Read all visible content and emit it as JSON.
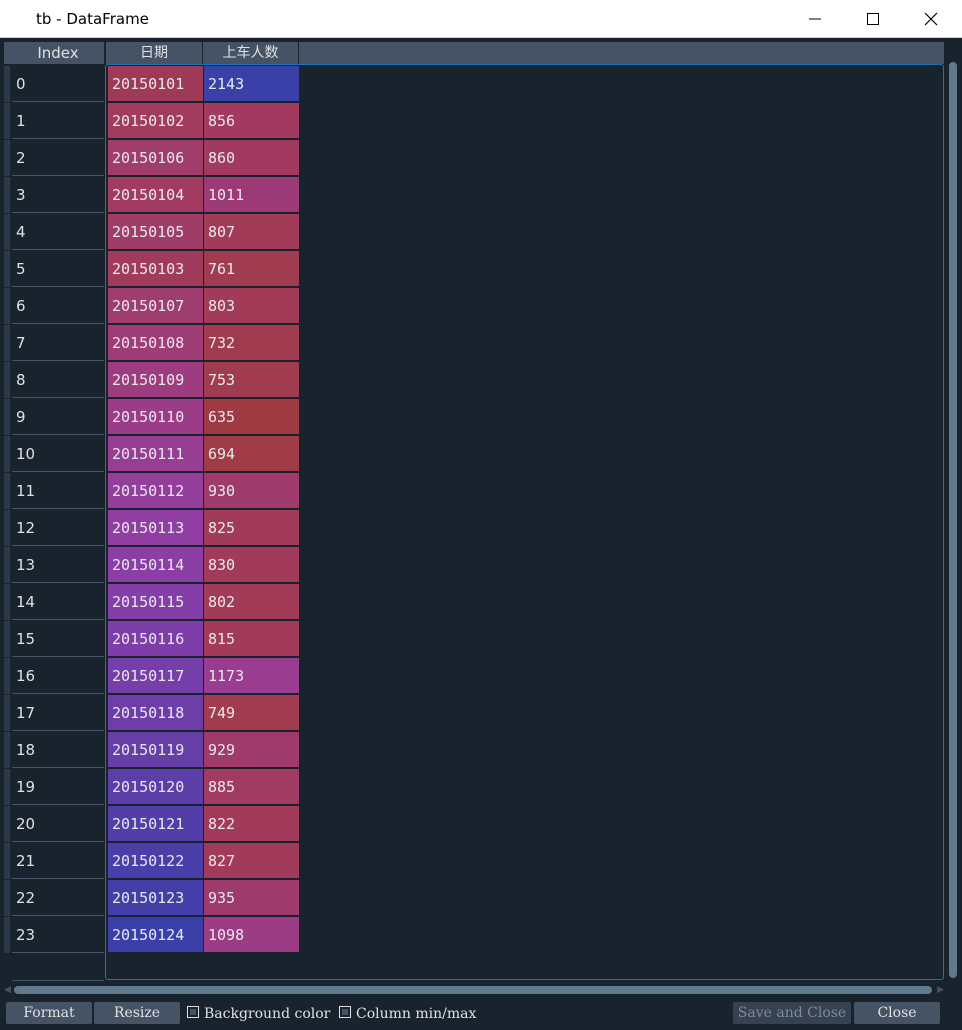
{
  "window": {
    "title": "tb - DataFrame",
    "controls": {
      "minimize": "minimize",
      "maximize": "maximize",
      "close": "close"
    }
  },
  "table": {
    "index_header": "Index",
    "columns": [
      "日期",
      "上车人数"
    ],
    "rows": [
      {
        "index": "0",
        "date": "20150101",
        "count": "2143",
        "date_color": "#9e3a56",
        "count_color": "#3b3fa8"
      },
      {
        "index": "1",
        "date": "20150102",
        "count": "856",
        "date_color": "#a23c5c",
        "count_color": "#a13a5e"
      },
      {
        "index": "2",
        "date": "20150106",
        "count": "860",
        "date_color": "#a03d6a",
        "count_color": "#a13a5e"
      },
      {
        "index": "3",
        "date": "20150104",
        "count": "1011",
        "date_color": "#a13c60",
        "count_color": "#9c3a78"
      },
      {
        "index": "4",
        "date": "20150105",
        "count": "807",
        "date_color": "#a03d66",
        "count_color": "#a23b58"
      },
      {
        "index": "5",
        "date": "20150103",
        "count": "761",
        "date_color": "#a13b5c",
        "count_color": "#a13b50"
      },
      {
        "index": "6",
        "date": "20150107",
        "count": "803",
        "date_color": "#9f3c70",
        "count_color": "#a23b58"
      },
      {
        "index": "7",
        "date": "20150108",
        "count": "732",
        "date_color": "#9e3c76",
        "count_color": "#a13b4e"
      },
      {
        "index": "8",
        "date": "20150109",
        "count": "753",
        "date_color": "#9d3c7e",
        "count_color": "#a13b50"
      },
      {
        "index": "9",
        "date": "20150110",
        "count": "635",
        "date_color": "#9b3c88",
        "count_color": "#9e3a42"
      },
      {
        "index": "10",
        "date": "20150111",
        "count": "694",
        "date_color": "#983d94",
        "count_color": "#a03b48"
      },
      {
        "index": "11",
        "date": "20150112",
        "count": "930",
        "date_color": "#943e9c",
        "count_color": "#9f3b6a"
      },
      {
        "index": "12",
        "date": "20150113",
        "count": "825",
        "date_color": "#903ea4",
        "count_color": "#a23b5a"
      },
      {
        "index": "13",
        "date": "20150114",
        "count": "830",
        "date_color": "#8a3ea6",
        "count_color": "#a23b5a"
      },
      {
        "index": "14",
        "date": "20150115",
        "count": "802",
        "date_color": "#843ea8",
        "count_color": "#a23b58"
      },
      {
        "index": "15",
        "date": "20150116",
        "count": "815",
        "date_color": "#7e3ea8",
        "count_color": "#a23b5a"
      },
      {
        "index": "16",
        "date": "20150117",
        "count": "1173",
        "date_color": "#763ea8",
        "count_color": "#9a3c90"
      },
      {
        "index": "17",
        "date": "20150118",
        "count": "749",
        "date_color": "#6e3ea8",
        "count_color": "#a13b50"
      },
      {
        "index": "18",
        "date": "20150119",
        "count": "929",
        "date_color": "#653ea8",
        "count_color": "#9f3b6a"
      },
      {
        "index": "19",
        "date": "20150120",
        "count": "885",
        "date_color": "#5c3ea8",
        "count_color": "#a13b62"
      },
      {
        "index": "20",
        "date": "20150121",
        "count": "822",
        "date_color": "#523ea8",
        "count_color": "#a23b5a"
      },
      {
        "index": "21",
        "date": "20150122",
        "count": "827",
        "date_color": "#4a3ea8",
        "count_color": "#a23b5a"
      },
      {
        "index": "22",
        "date": "20150123",
        "count": "935",
        "date_color": "#433ea8",
        "count_color": "#9f3b6c"
      },
      {
        "index": "23",
        "date": "20150124",
        "count": "1098",
        "date_color": "#3b40a8",
        "count_color": "#9b3c84"
      }
    ]
  },
  "toolbar": {
    "format_label": "Format",
    "resize_label": "Resize",
    "bg_color_label": "Background color",
    "minmax_label": "Column min/max",
    "save_close_label": "Save and Close",
    "close_label": "Close"
  },
  "colors": {
    "background": "#19232d",
    "header": "#455364",
    "focus_border": "#1a72bb",
    "text": "#e0e1e3"
  }
}
